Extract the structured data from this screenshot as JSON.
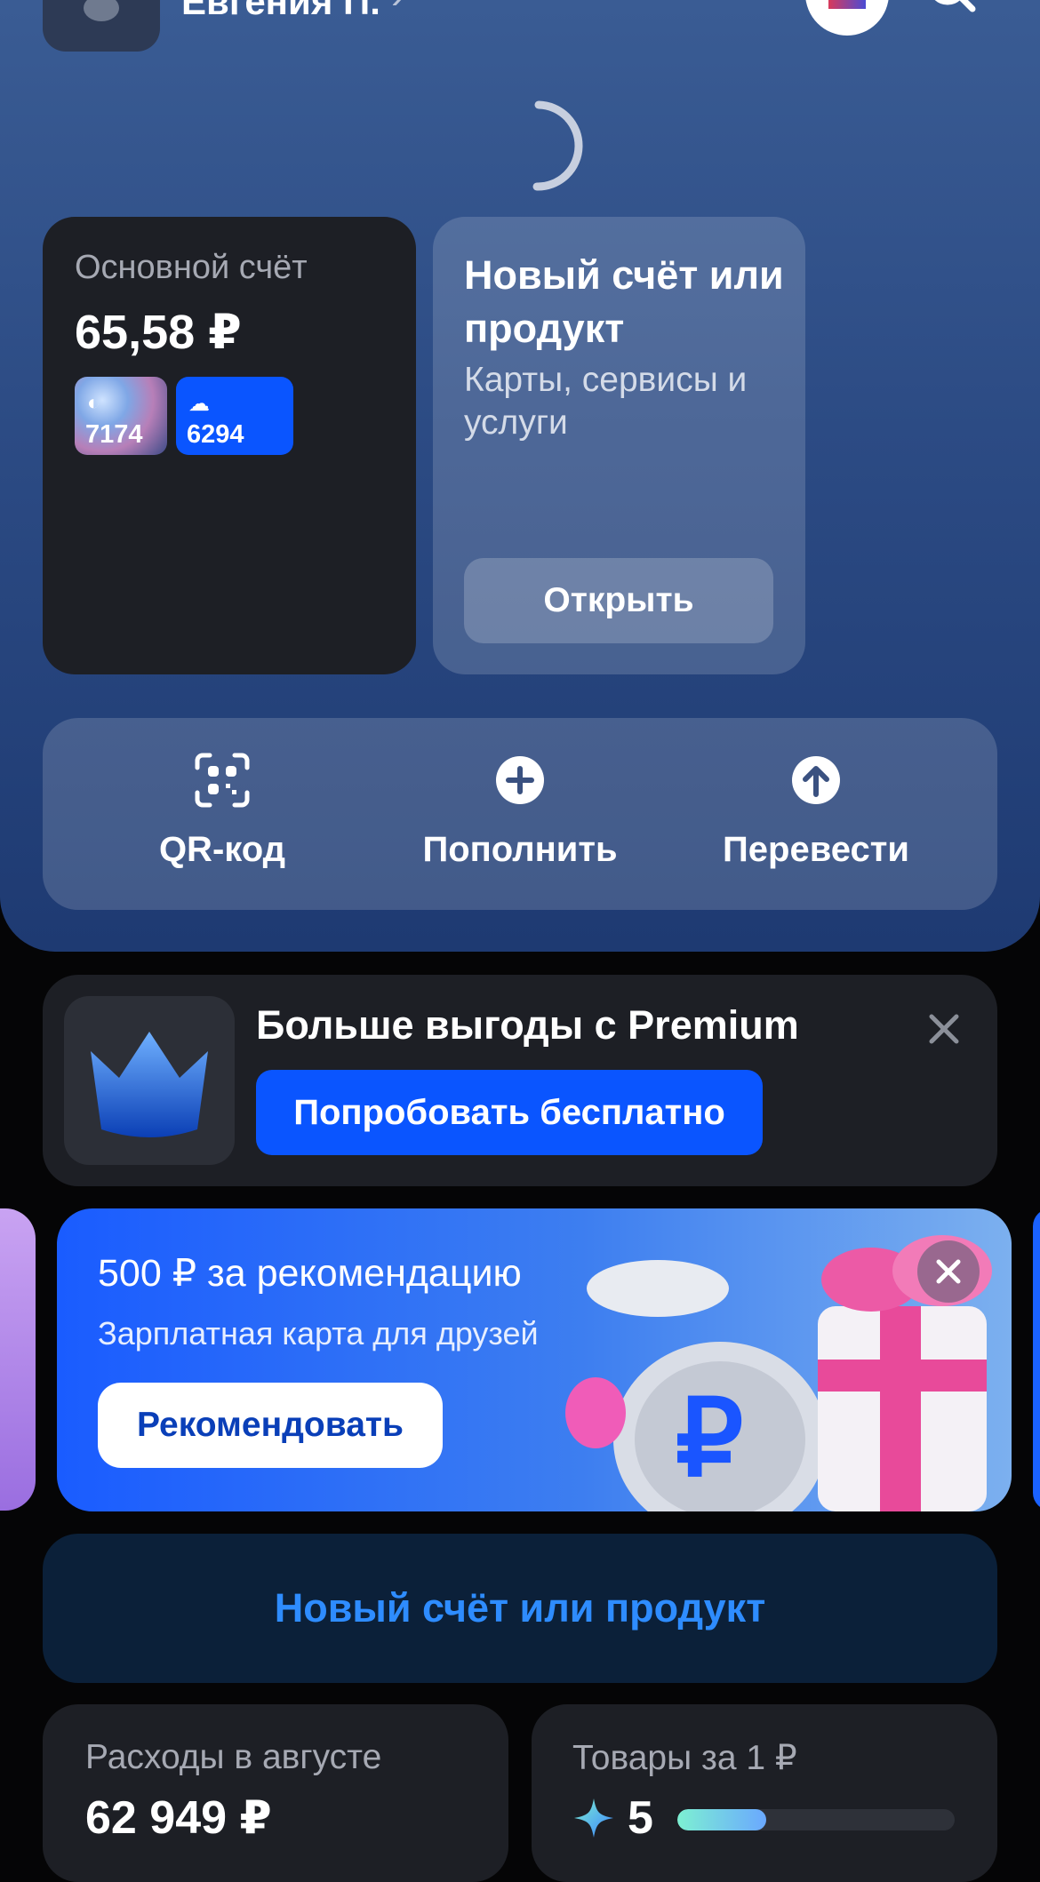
{
  "header": {
    "user_name": "Евгения П.",
    "chevron": "›"
  },
  "main_account": {
    "title": "Основной счёт",
    "balance": "65,58 ₽",
    "cards": [
      {
        "number": "7174",
        "icon": "card-art"
      },
      {
        "number": "6294",
        "icon": "cloud-icon"
      }
    ]
  },
  "new_product_card": {
    "title": "Новый счёт или продукт",
    "subtitle": "Карты, сервисы и услуги",
    "button": "Открыть"
  },
  "quick_actions": [
    {
      "label": "QR-код",
      "icon": "qr-scan-icon"
    },
    {
      "label": "Пополнить",
      "icon": "plus-circle-icon"
    },
    {
      "label": "Перевести",
      "icon": "arrow-up-circle-icon"
    }
  ],
  "premium_banner": {
    "title": "Больше выгоды с Premium",
    "button": "Попробовать бесплатно"
  },
  "referral_banner": {
    "title": "500 ₽ за рекомендацию",
    "subtitle": "Зарплатная карта для друзей",
    "button": "Рекомендовать"
  },
  "new_account_button": "Новый счёт или продукт",
  "tiles": {
    "spending": {
      "title": "Расходы в августе",
      "value": "62 949 ₽"
    },
    "goods": {
      "title": "Товары за 1 ₽",
      "count": "5",
      "progress": 0.32
    }
  },
  "colors": {
    "accent": "#0a55ff",
    "link": "#2e8cff",
    "surface": "#1d1f25",
    "background": "#050506"
  }
}
